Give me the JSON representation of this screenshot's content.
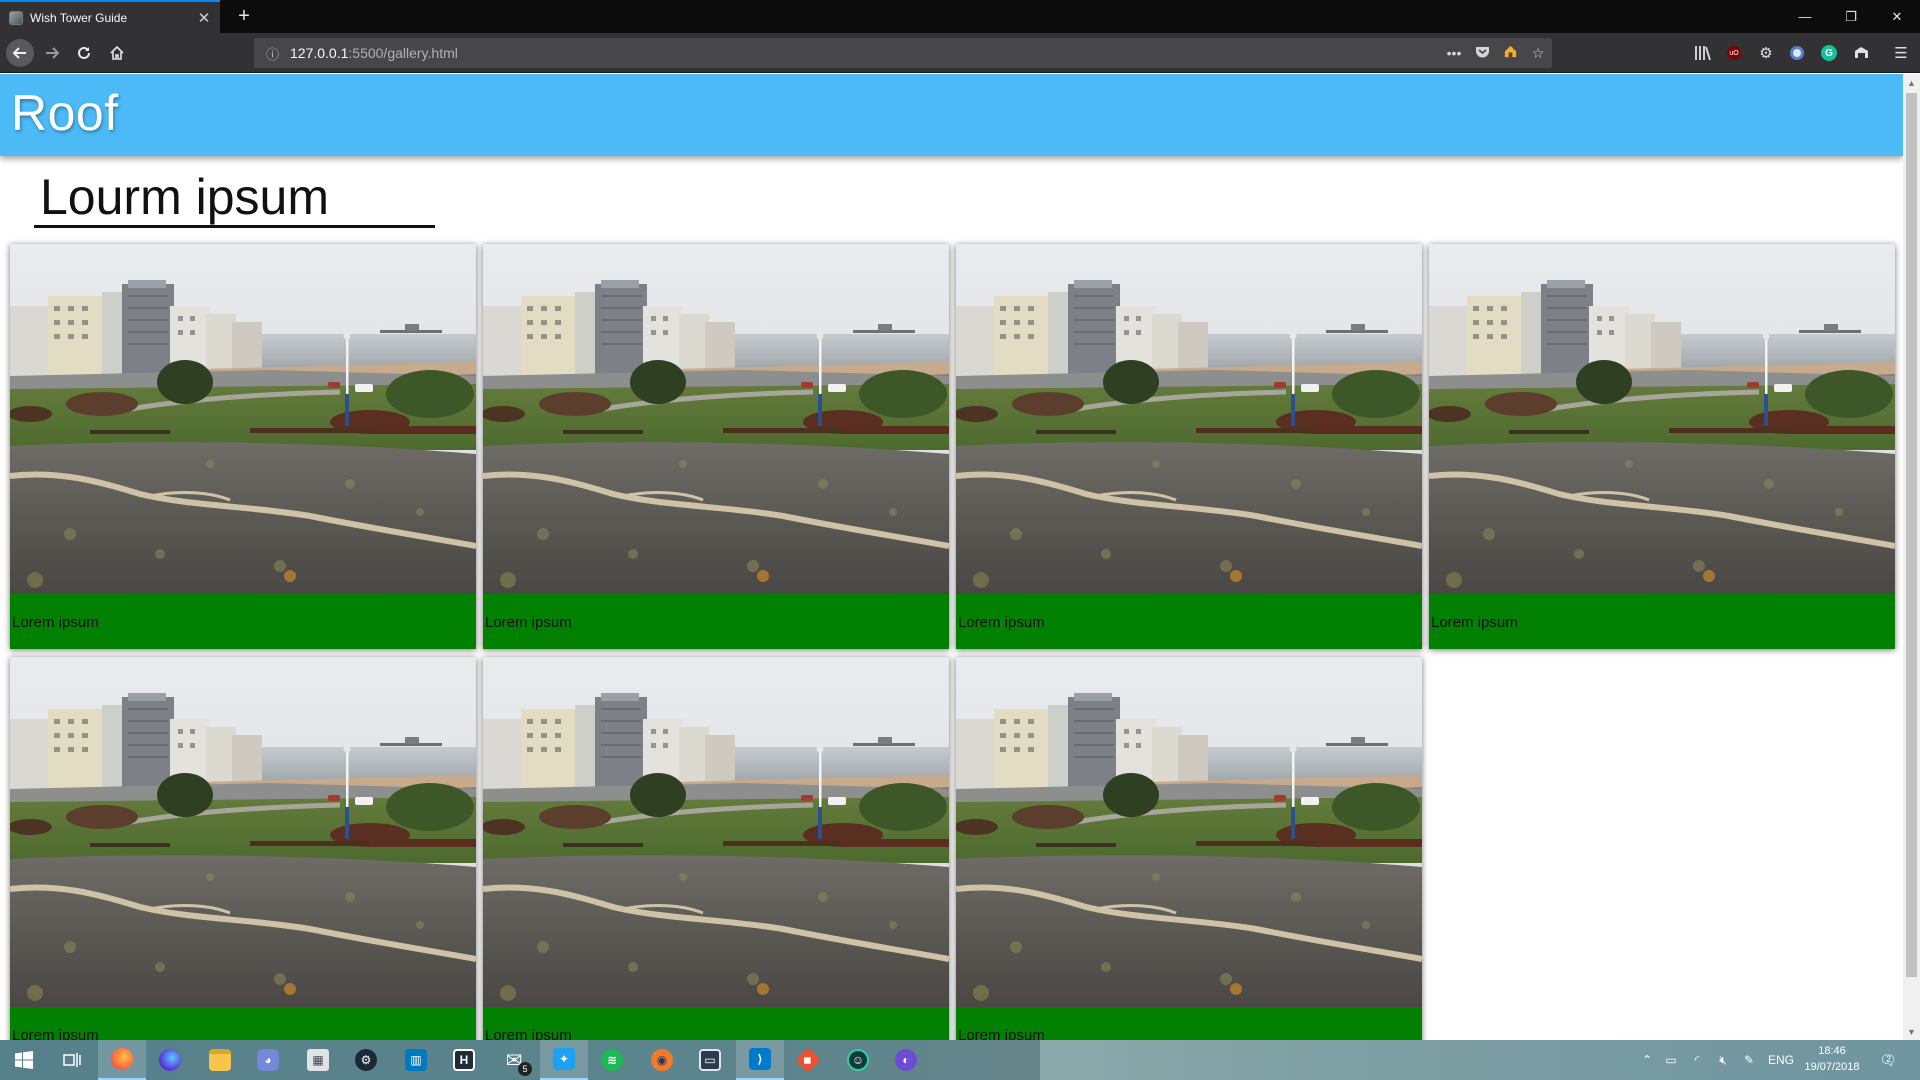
{
  "browser": {
    "tab_title": "Wish Tower Guide",
    "tab_close": "✕",
    "new_tab": "+",
    "url_host": "127.0.0.1",
    "url_path": ":5500/gallery.html",
    "page_actions": "•••",
    "window_controls": {
      "minimize": "—",
      "restore": "❐",
      "close": "✕"
    }
  },
  "page": {
    "site_title": "Roof",
    "heading": "Lourm ipsum",
    "cards": [
      {
        "caption": "Lorem ipsum"
      },
      {
        "caption": "Lorem ipsum"
      },
      {
        "caption": "Lorem ipsum"
      },
      {
        "caption": "Lorem ipsum"
      },
      {
        "caption": "Lorem ipsum"
      },
      {
        "caption": "Lorem ipsum"
      },
      {
        "caption": "Lorem ipsum"
      }
    ],
    "colors": {
      "header": "#4cbaf6",
      "caption_bar": "#028002"
    }
  },
  "taskbar": {
    "apps": [
      "windows-start-icon",
      "task-view-icon",
      "firefox-icon",
      "firefox-nightly-icon",
      "file-explorer-icon",
      "discord-icon",
      "app-icon",
      "steam-icon",
      "trello-icon",
      "app-icon",
      "mail-icon",
      "twitter-icon",
      "spotify-icon",
      "blender-icon",
      "app-icon",
      "vscode-icon",
      "git-icon",
      "gitkraken-icon",
      "app-icon"
    ],
    "mail_badge": "5",
    "language": "ENG",
    "time": "18:46",
    "date": "19/07/2018",
    "notification_count": "2"
  }
}
